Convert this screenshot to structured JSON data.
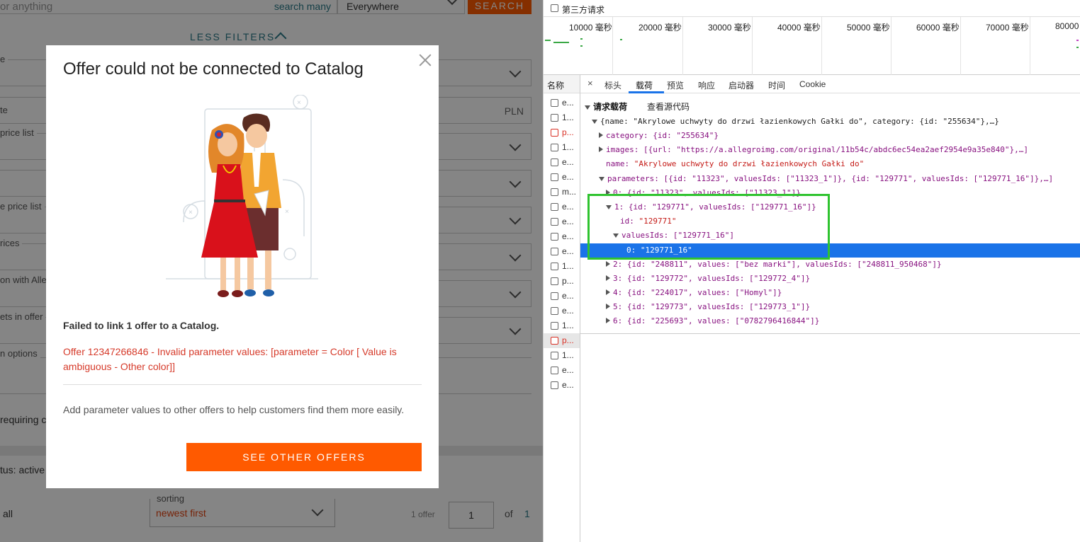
{
  "app": {
    "search_placeholder": "or anything",
    "search_many_label": "search many",
    "where_select": "Everywhere",
    "search_button": "SEARCH",
    "less_filters": "LESS FILTERS",
    "filter_labels": [
      "e",
      "te",
      "price list",
      "e price list",
      "rices",
      "on with Alle",
      "ets in offer",
      "n options",
      "requiring c"
    ],
    "currency": "PLN",
    "status_label": "tus: active",
    "all_label": "all",
    "sorting_label": "sorting",
    "sorting_value": "newest first",
    "offer_count": "1 offer",
    "page_number": "1",
    "of_label": "of",
    "total_pages": "1"
  },
  "modal": {
    "title": "Offer could not be connected to Catalog",
    "failed_text": "Failed to link 1 offer to a Catalog.",
    "error_text": "Offer 12347266846 - Invalid parameter values: [parameter = Color [ Value is ambiguous - Other color]]",
    "hint_text": "Add parameter values to other offers to help customers find them more easily.",
    "button_label": "SEE OTHER OFFERS"
  },
  "devtools": {
    "third_party_label": "第三方请求",
    "timeline_labels": [
      "10000 毫秒",
      "20000 毫秒",
      "30000 毫秒",
      "40000 毫秒",
      "50000 毫秒",
      "60000 毫秒",
      "70000 毫秒",
      "80000"
    ],
    "names_header": "名称",
    "request_names": [
      "e...",
      "1...",
      "p...",
      "1...",
      "e...",
      "e...",
      "m...",
      "e...",
      "e...",
      "e...",
      "e...",
      "1...",
      "p...",
      "e...",
      "e...",
      "1...",
      "p...",
      "1...",
      "e...",
      "e..."
    ],
    "tabs": [
      "标头",
      "载荷",
      "预览",
      "响应",
      "启动器",
      "时间",
      "Cookie"
    ],
    "payload_header": "请求载荷",
    "view_source": "查看源代码",
    "payload_lines": {
      "root": "{name: \"Akrylowe uchwyty do drzwi łazienkowych Gałki do\", category: {id: \"255634\"},…}",
      "category": "category: {id: \"255634\"}",
      "images": "images: [{url: \"https://a.allegroimg.com/original/11b54c/abdc6ec54ea2aef2954e9a35e840\"},…]",
      "name_key": "name: ",
      "name_val": "\"Akrylowe uchwyty do drzwi łazienkowych Gałki do\"",
      "parameters": "parameters: [{id: \"11323\", valuesIds: [\"11323_1\"]}, {id: \"129771\", valuesIds: [\"129771_16\"]},…]",
      "p0": "0: {id: \"11323\", valuesIds: [\"11323_1\"]}",
      "p1": "1: {id: \"129771\", valuesIds: [\"129771_16\"]}",
      "p1_id_key": "id: ",
      "p1_id_val": "\"129771\"",
      "p1_values": "valuesIds: [\"129771_16\"]",
      "p1_v0_key": "0: ",
      "p1_v0_val": "\"129771_16\"",
      "p2": "2: {id: \"248811\", values: [\"bez marki\"], valuesIds: [\"248811_950468\"]}",
      "p3": "3: {id: \"129772\", valuesIds: [\"129772_4\"]}",
      "p4": "4: {id: \"224017\", values: [\"Homyl\"]}",
      "p5": "5: {id: \"129773\", valuesIds: [\"129773_1\"]}",
      "p6": "6: {id: \"225693\", values: [\"0782796416844\"]}"
    }
  }
}
